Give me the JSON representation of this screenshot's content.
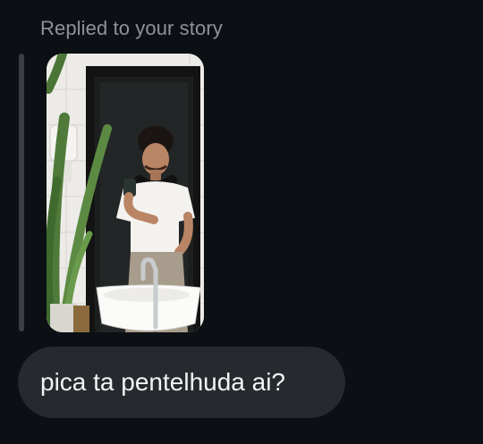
{
  "reply": {
    "caption": "Replied to your story"
  },
  "story": {
    "image_icon": "story-photo",
    "subject": "mirror selfie in bathroom"
  },
  "message": {
    "text": "pica ta pentelhuda ai?"
  },
  "colors": {
    "background": "#0c0f14",
    "caption": "#8e939b",
    "reply_line": "#3a3e45",
    "bubble": "#26292e",
    "message_text": "#f2f3f5"
  }
}
